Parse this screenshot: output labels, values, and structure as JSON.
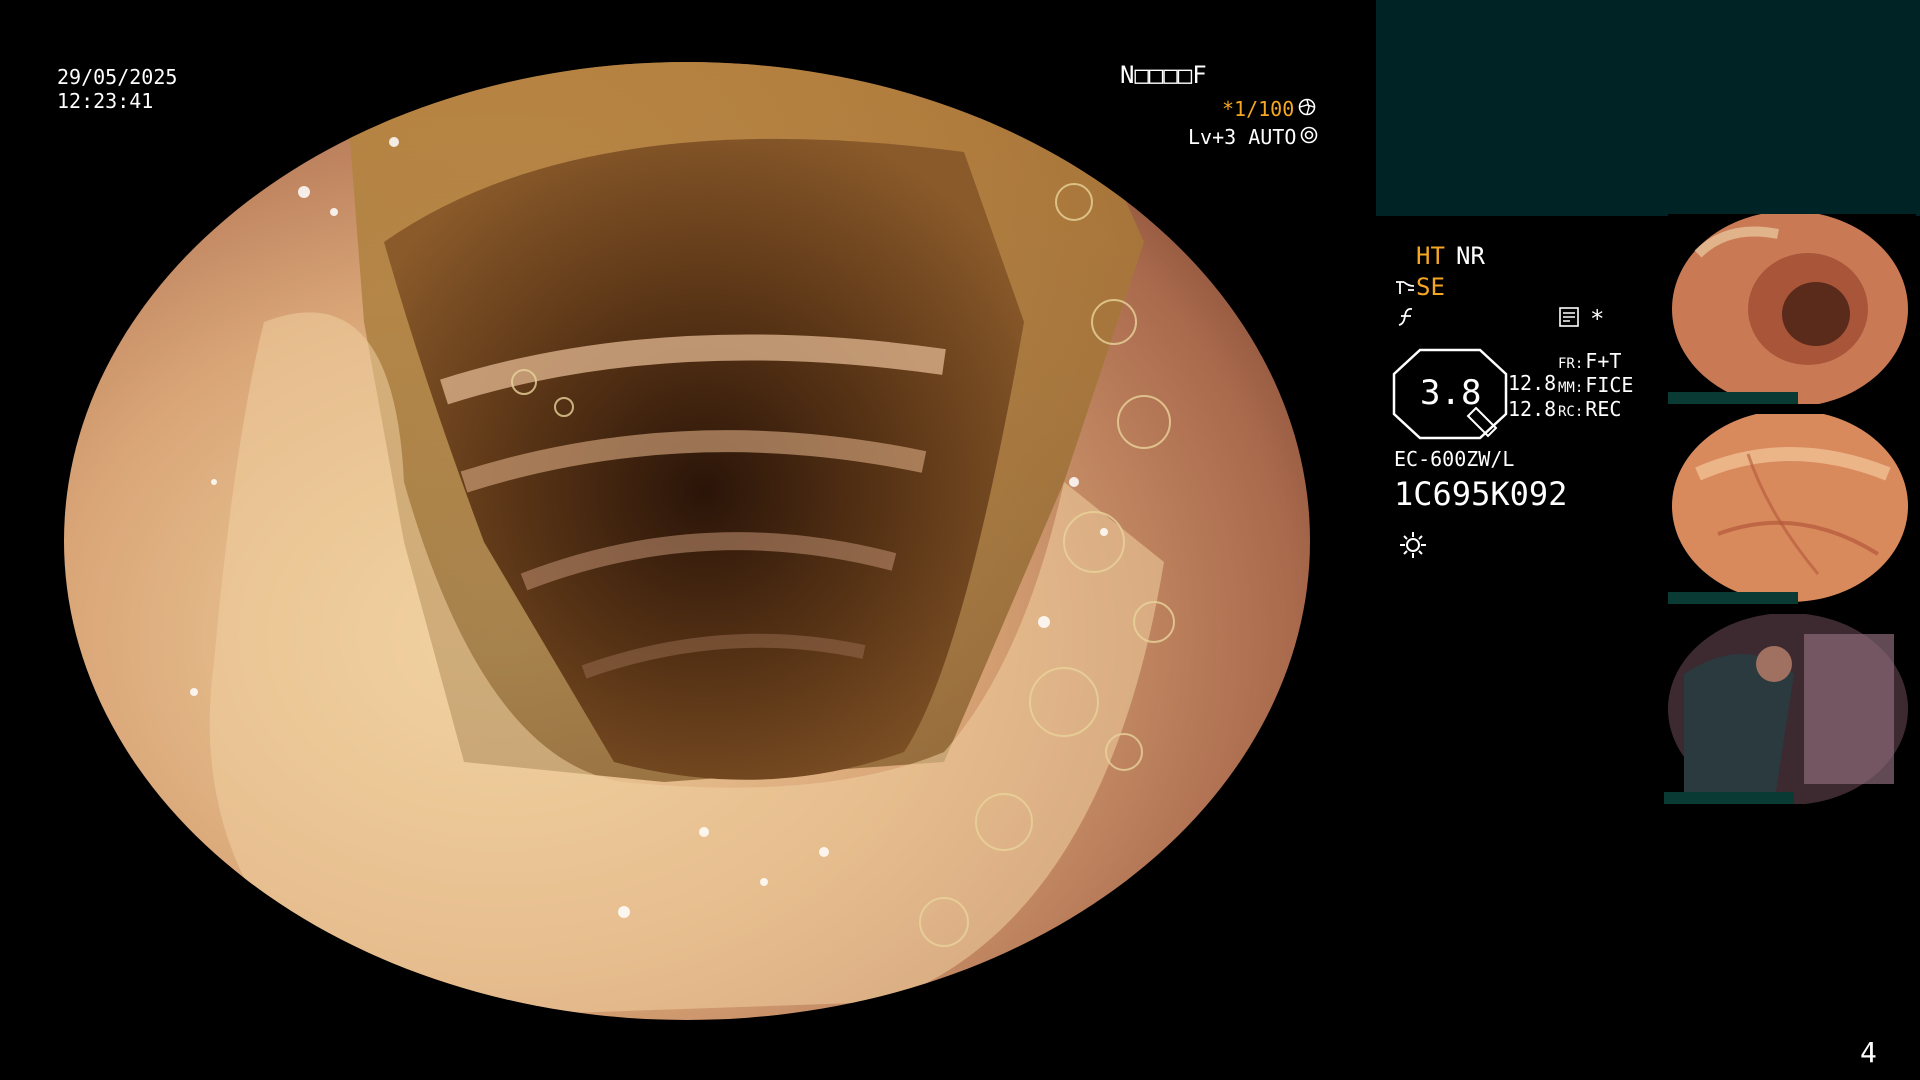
{
  "overlay": {
    "date": "29/05/2025",
    "time": "12:23:41",
    "patient_id": "N□□□□F",
    "shutter": "*1/100",
    "level": "Lv+3 AUTO",
    "page_number": "4"
  },
  "status_panel": {
    "ht": "HT",
    "nr": "NR",
    "se": "SE",
    "magnification": "3.8",
    "value_row1": "12.8",
    "value_row2": "12.8",
    "fr_label": "FR:",
    "fr_value": "F+T",
    "mm_label": "MM:",
    "mm_value": "FICE",
    "rc_label": "RC:",
    "rc_value": "REC",
    "asterisk": "*",
    "scope_model": "EC-600ZW/L",
    "serial": "1C695K092"
  },
  "icons": {
    "shutter_icon": "aperture-icon",
    "auto_icon": "iris-icon",
    "light_icon": "sun-icon",
    "se_icon": "enhancement-icon",
    "f_icon": "function-icon",
    "memo_icon": "memo-icon"
  },
  "colors": {
    "accent_orange": "#f5a623",
    "panel_teal": "#002426",
    "thumb_bar": "#0a3a34"
  }
}
